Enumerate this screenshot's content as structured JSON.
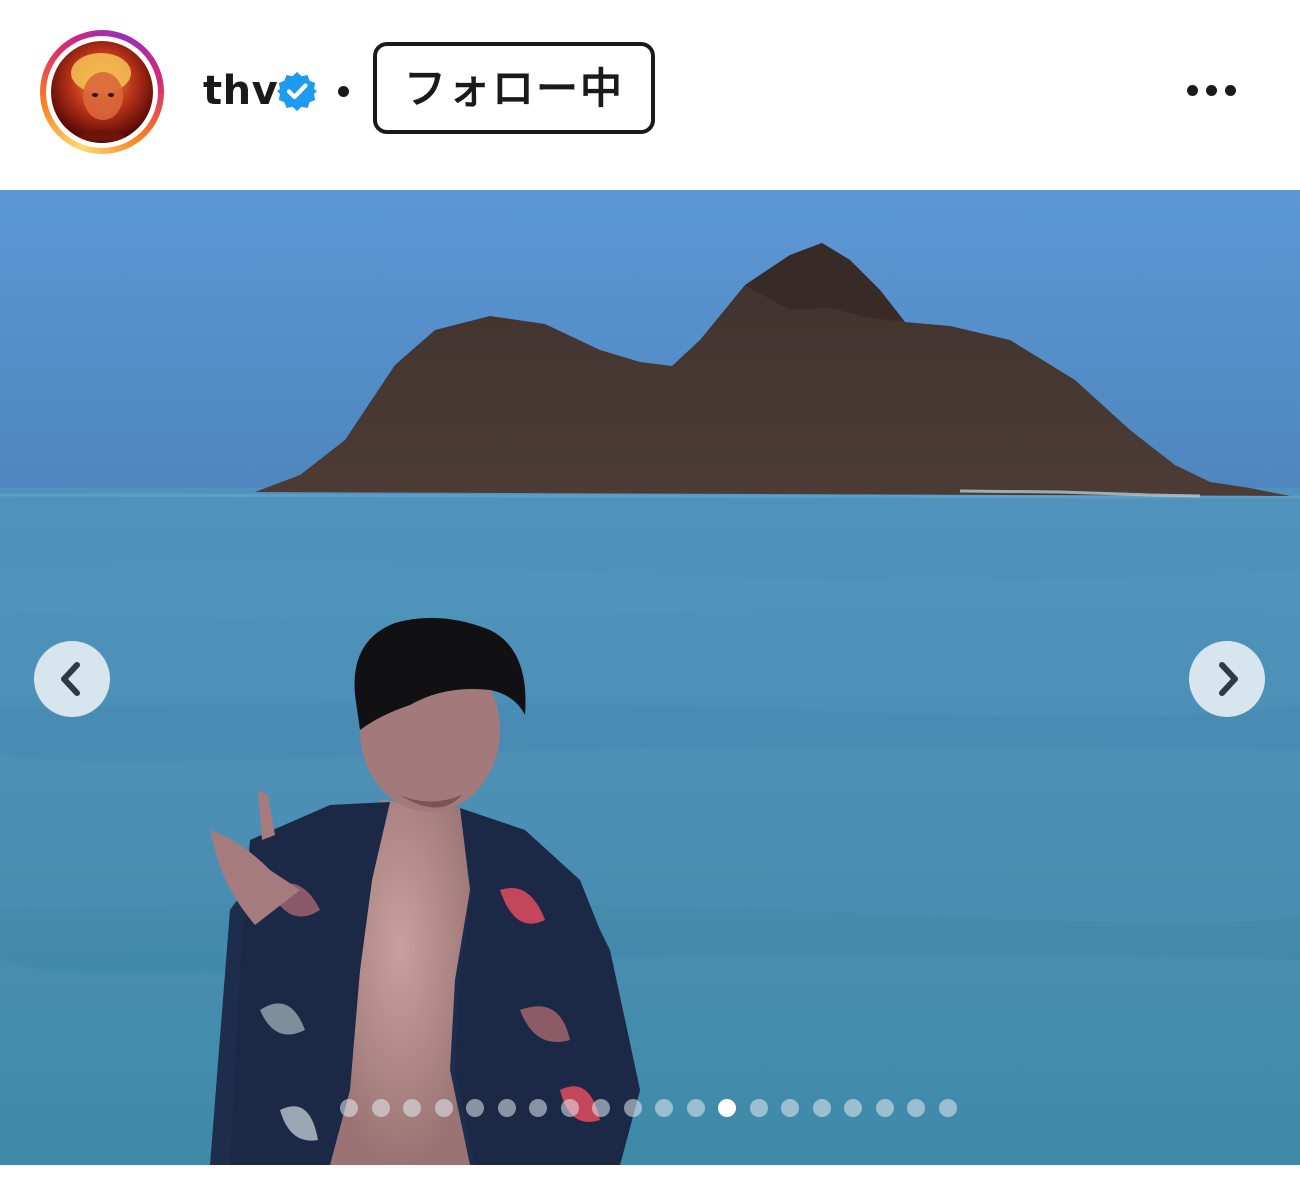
{
  "post": {
    "username": "thv",
    "verified": true,
    "separator": "•",
    "follow_label": "フォロー中",
    "more_icon": "more-horizontal-icon"
  },
  "media": {
    "carousel_total": 20,
    "carousel_current": 13,
    "prev_icon": "chevron-left-icon",
    "next_icon": "chevron-right-icon"
  },
  "colors": {
    "verified": "#1d9bf0",
    "sky": "#5f96d2",
    "sea": "#4a91b2",
    "island": "#4a3832"
  }
}
